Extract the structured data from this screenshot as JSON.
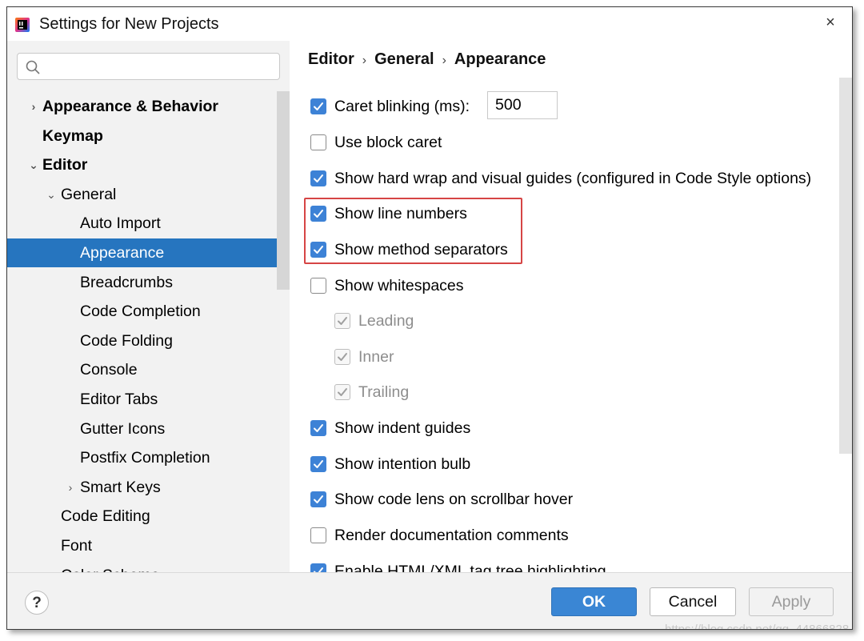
{
  "window": {
    "title": "Settings for New Projects",
    "close_glyph": "×"
  },
  "search": {
    "placeholder": "",
    "value": ""
  },
  "tree": [
    {
      "label": "Appearance & Behavior",
      "arrow": "›",
      "bold": true,
      "selected": false
    },
    {
      "label": "Keymap",
      "arrow": "",
      "bold": true,
      "selected": false
    },
    {
      "label": "Editor",
      "arrow": "⌄",
      "bold": true,
      "selected": false
    },
    {
      "label": "General",
      "arrow": "⌄",
      "bold": false,
      "selected": false
    },
    {
      "label": "Auto Import",
      "arrow": "",
      "bold": false,
      "selected": false
    },
    {
      "label": "Appearance",
      "arrow": "",
      "bold": false,
      "selected": true
    },
    {
      "label": "Breadcrumbs",
      "arrow": "",
      "bold": false,
      "selected": false
    },
    {
      "label": "Code Completion",
      "arrow": "",
      "bold": false,
      "selected": false
    },
    {
      "label": "Code Folding",
      "arrow": "",
      "bold": false,
      "selected": false
    },
    {
      "label": "Console",
      "arrow": "",
      "bold": false,
      "selected": false
    },
    {
      "label": "Editor Tabs",
      "arrow": "",
      "bold": false,
      "selected": false
    },
    {
      "label": "Gutter Icons",
      "arrow": "",
      "bold": false,
      "selected": false
    },
    {
      "label": "Postfix Completion",
      "arrow": "",
      "bold": false,
      "selected": false
    },
    {
      "label": "Smart Keys",
      "arrow": "›",
      "bold": false,
      "selected": false
    },
    {
      "label": "Code Editing",
      "arrow": "",
      "bold": false,
      "selected": false
    },
    {
      "label": "Font",
      "arrow": "",
      "bold": false,
      "selected": false
    },
    {
      "label": "Color Scheme",
      "arrow": "›",
      "bold": false,
      "selected": false
    }
  ],
  "breadcrumb": {
    "items": [
      "Editor",
      "General",
      "Appearance"
    ],
    "separator": "›"
  },
  "options": [
    {
      "label": "Caret blinking (ms):",
      "checked": true,
      "disabled": false
    },
    {
      "label": "Use block caret",
      "checked": false,
      "disabled": false
    },
    {
      "label": "Show hard wrap and visual guides (configured in Code Style options)",
      "checked": true,
      "disabled": false
    },
    {
      "label": "Show line numbers",
      "checked": true,
      "disabled": false
    },
    {
      "label": "Show method separators",
      "checked": true,
      "disabled": false
    },
    {
      "label": "Show whitespaces",
      "checked": false,
      "disabled": false
    },
    {
      "label": "Leading",
      "checked": true,
      "disabled": true
    },
    {
      "label": "Inner",
      "checked": true,
      "disabled": true
    },
    {
      "label": "Trailing",
      "checked": true,
      "disabled": true
    },
    {
      "label": "Show indent guides",
      "checked": true,
      "disabled": false
    },
    {
      "label": "Show intention bulb",
      "checked": true,
      "disabled": false
    },
    {
      "label": "Show code lens on scrollbar hover",
      "checked": true,
      "disabled": false
    },
    {
      "label": "Render documentation comments",
      "checked": false,
      "disabled": false
    },
    {
      "label": "Enable HTML/XML tag tree highlighting",
      "checked": true,
      "disabled": false
    }
  ],
  "caret_blink_value": "500",
  "buttons": {
    "help": "?",
    "ok": "OK",
    "cancel": "Cancel",
    "apply": "Apply"
  },
  "watermark": "https://blog.csdn.net/qq_44866828",
  "colors": {
    "selection": "#2675bf",
    "checkbox": "#3d82d6",
    "highlight_box": "#d64545",
    "ok_button": "#3a86d4"
  },
  "icons": {
    "app": "intellij-app-icon",
    "search": "search-icon",
    "close": "close-icon"
  }
}
